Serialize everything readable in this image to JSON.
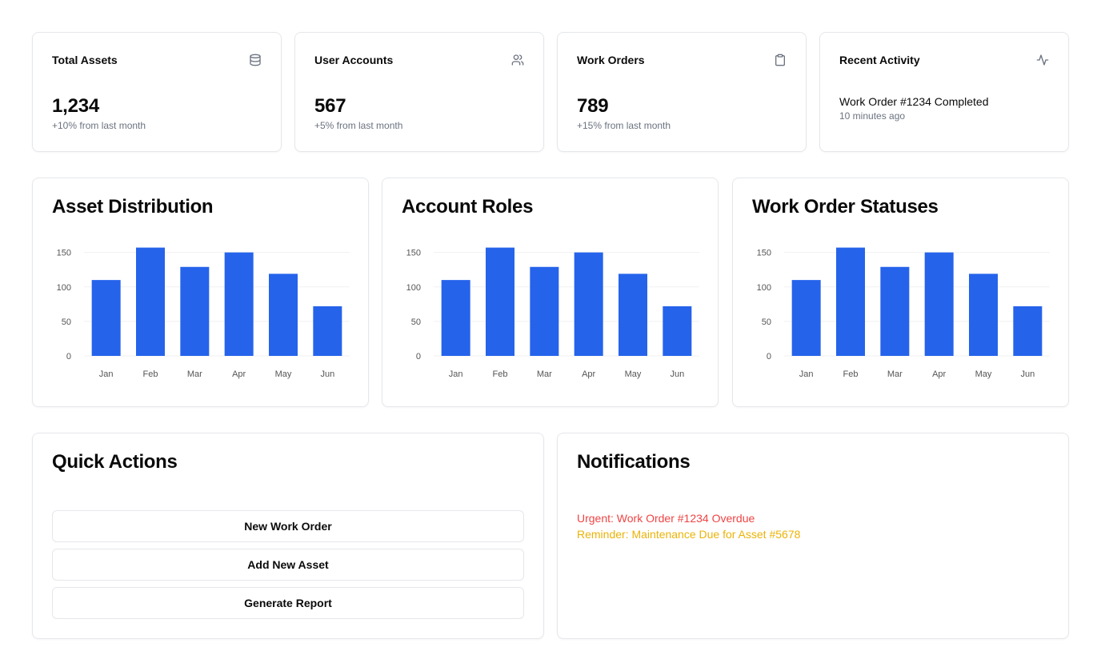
{
  "stats": [
    {
      "title": "Total Assets",
      "value": "1,234",
      "sub": "+10% from last month",
      "icon": "database-icon"
    },
    {
      "title": "User Accounts",
      "value": "567",
      "sub": "+5% from last month",
      "icon": "users-icon"
    },
    {
      "title": "Work Orders",
      "value": "789",
      "sub": "+15% from last month",
      "icon": "clipboard-icon"
    }
  ],
  "recent_activity": {
    "title": "Recent Activity",
    "item": "Work Order #1234 Completed",
    "time": "10 minutes ago",
    "icon": "activity-icon"
  },
  "chart_data": [
    {
      "type": "bar",
      "title": "Asset Distribution",
      "categories": [
        "Jan",
        "Feb",
        "Mar",
        "Apr",
        "May",
        "Jun"
      ],
      "values": [
        110,
        157,
        129,
        150,
        119,
        72
      ],
      "ylim": [
        0,
        160
      ],
      "yticks": [
        0,
        50,
        100,
        150
      ],
      "color": "#2563eb",
      "grid": true
    },
    {
      "type": "bar",
      "title": "Account Roles",
      "categories": [
        "Jan",
        "Feb",
        "Mar",
        "Apr",
        "May",
        "Jun"
      ],
      "values": [
        110,
        157,
        129,
        150,
        119,
        72
      ],
      "ylim": [
        0,
        160
      ],
      "yticks": [
        0,
        50,
        100,
        150
      ],
      "color": "#2563eb",
      "grid": true
    },
    {
      "type": "bar",
      "title": "Work Order Statuses",
      "categories": [
        "Jan",
        "Feb",
        "Mar",
        "Apr",
        "May",
        "Jun"
      ],
      "values": [
        110,
        157,
        129,
        150,
        119,
        72
      ],
      "ylim": [
        0,
        160
      ],
      "yticks": [
        0,
        50,
        100,
        150
      ],
      "color": "#2563eb",
      "grid": true
    }
  ],
  "quick_actions": {
    "title": "Quick Actions",
    "buttons": [
      "New Work Order",
      "Add New Asset",
      "Generate Report"
    ]
  },
  "notifications": {
    "title": "Notifications",
    "items": [
      {
        "text": "Urgent: Work Order #1234 Overdue",
        "color": "#ef4444"
      },
      {
        "text": "Reminder: Maintenance Due for Asset #5678",
        "color": "#eab308"
      }
    ]
  }
}
